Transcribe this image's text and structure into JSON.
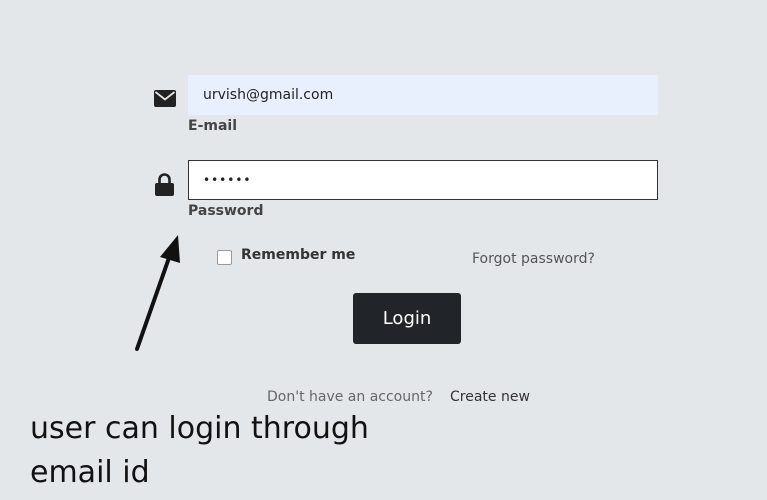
{
  "form": {
    "email": {
      "icon": "envelope-icon",
      "value": "urvish@gmail.com",
      "label": "E-mail"
    },
    "password": {
      "icon": "lock-icon",
      "value": "••••••",
      "label": "Password"
    },
    "remember_label": "Remember me",
    "forgot_label": "Forgot password?",
    "login_label": "Login",
    "signup_prompt": "Don't have an account?",
    "signup_link": "Create new"
  },
  "annotation": {
    "line1": "user can login through",
    "line2": "email id"
  },
  "colors": {
    "background": "#e4e7ea",
    "email_field_bg": "#e8f0fe",
    "button_bg": "#212529"
  }
}
